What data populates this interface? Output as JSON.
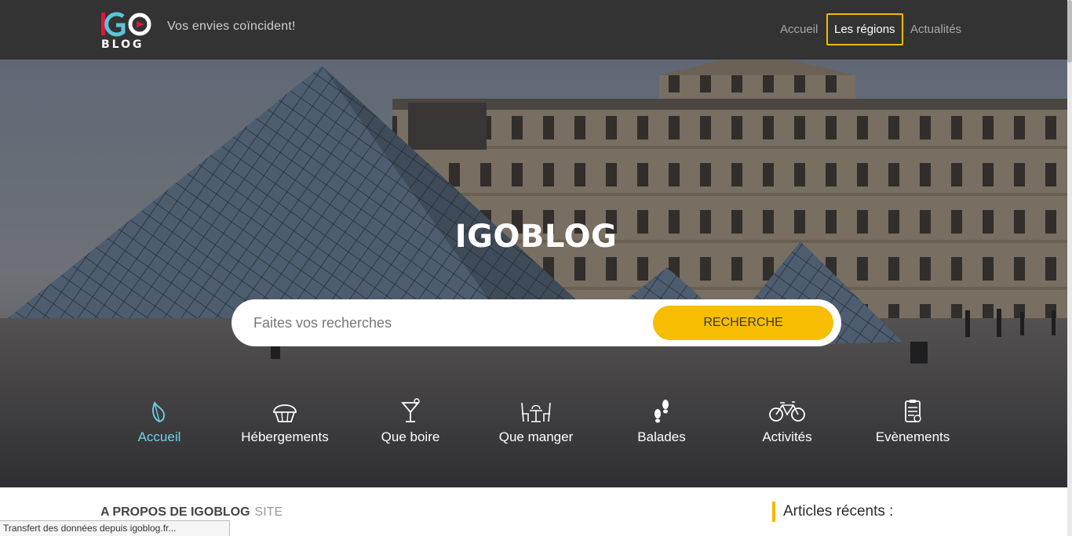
{
  "header": {
    "logo_top": "IGO",
    "logo_bottom": "BLOG",
    "tagline": "Vos envies coïncident!",
    "nav": [
      {
        "label": "Accueil",
        "active": false
      },
      {
        "label": "Les régions",
        "active": true
      },
      {
        "label": "Actualités",
        "active": false
      }
    ]
  },
  "hero": {
    "title": "IGOBLOG",
    "search": {
      "placeholder": "Faites vos recherches",
      "button_label": "RECHERCHE"
    },
    "categories": [
      {
        "label": "Accueil",
        "icon": "leaf-icon",
        "active": true
      },
      {
        "label": "Hébergements",
        "icon": "cupcake-icon",
        "active": false
      },
      {
        "label": "Que boire",
        "icon": "cocktail-icon",
        "active": false
      },
      {
        "label": "Que manger",
        "icon": "dining-table-icon",
        "active": false
      },
      {
        "label": "Balades",
        "icon": "footprints-icon",
        "active": false
      },
      {
        "label": "Activités",
        "icon": "bicycle-icon",
        "active": false
      },
      {
        "label": "Evènements",
        "icon": "clipboard-icon",
        "active": false
      }
    ]
  },
  "about": {
    "heading": "A PROPOS DE IGOBLOG",
    "suffix": "SITE"
  },
  "sidebar": {
    "recent_heading": "Articles récents :"
  },
  "status": {
    "text": "Transfert des données depuis igoblog.fr..."
  },
  "colors": {
    "header_bg": "#333333",
    "accent_yellow": "#f7bd00",
    "active_category": "#6fd3ea",
    "logo_red": "#e2163c",
    "logo_blue": "#5bc4d8"
  }
}
